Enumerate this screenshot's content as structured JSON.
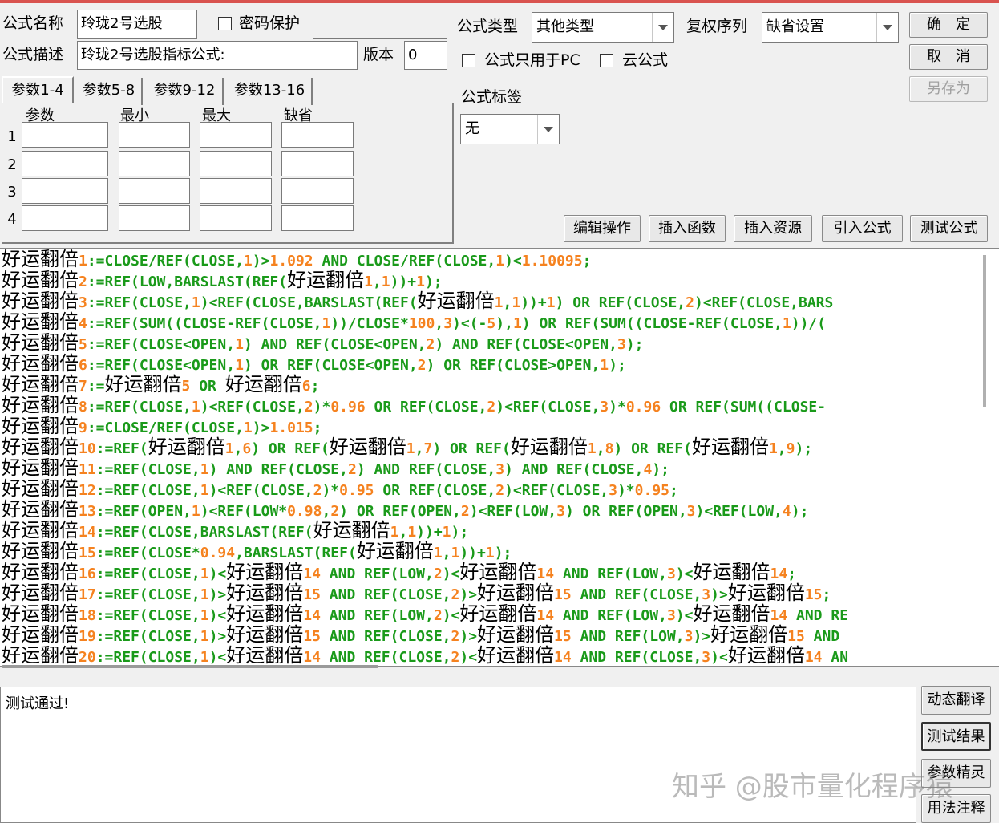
{
  "labels": {
    "name": "公式名称",
    "password": "密码保护",
    "desc": "公式描述",
    "version": "版本",
    "type": "公式类型",
    "fuquan": "复权序列",
    "pc_only": "公式只用于PC",
    "cloud": "云公式",
    "tag": "公式标签"
  },
  "values": {
    "name": "玲珑2号选股",
    "desc": "玲珑2号选股指标公式:",
    "version": "0",
    "type": "其他类型",
    "fuquan": "缺省设置",
    "tag": "无"
  },
  "buttons": {
    "ok": "确　定",
    "cancel": "取　消",
    "save_as": "另存为",
    "edit_ops": "编辑操作",
    "insert_func": "插入函数",
    "insert_res": "插入资源",
    "import": "引入公式",
    "test": "测试公式",
    "translate": "动态翻译",
    "test_result": "测试结果",
    "param_guide": "参数精灵",
    "usage": "用法注释"
  },
  "tabs": [
    "参数1-4",
    "参数5-8",
    "参数9-12",
    "参数13-16"
  ],
  "param_headers": [
    "参数",
    "最小",
    "最大",
    "缺省"
  ],
  "param_rows": [
    "1",
    "2",
    "3",
    "4"
  ],
  "code_lines": [
    "好运翻倍1:=CLOSE/REF(CLOSE,1)>1.092 AND CLOSE/REF(CLOSE,1)<1.10095;",
    "好运翻倍2:=REF(LOW,BARSLAST(REF(好运翻倍1,1))+1);",
    "好运翻倍3:=REF(CLOSE,1)<REF(CLOSE,BARSLAST(REF(好运翻倍1,1))+1) OR REF(CLOSE,2)<REF(CLOSE,BARS",
    "好运翻倍4:=REF(SUM((CLOSE-REF(CLOSE,1))/CLOSE*100,3)<(-5),1) OR REF(SUM((CLOSE-REF(CLOSE,1))/(",
    "好运翻倍5:=REF(CLOSE<OPEN,1) AND REF(CLOSE<OPEN,2) AND REF(CLOSE<OPEN,3);",
    "好运翻倍6:=REF(CLOSE<OPEN,1) OR REF(CLOSE<OPEN,2) OR REF(CLOSE>OPEN,1);",
    "好运翻倍7:=好运翻倍5 OR 好运翻倍6;",
    "好运翻倍8:=REF(CLOSE,1)<REF(CLOSE,2)*0.96 OR REF(CLOSE,2)<REF(CLOSE,3)*0.96 OR REF(SUM((CLOSE-",
    "好运翻倍9:=CLOSE/REF(CLOSE,1)>1.015;",
    "好运翻倍10:=REF(好运翻倍1,6) OR REF(好运翻倍1,7) OR REF(好运翻倍1,8) OR REF(好运翻倍1,9);",
    "好运翻倍11:=REF(CLOSE,1) AND REF(CLOSE,2) AND REF(CLOSE,3) AND REF(CLOSE,4);",
    "好运翻倍12:=REF(CLOSE,1)<REF(CLOSE,2)*0.95 OR REF(CLOSE,2)<REF(CLOSE,3)*0.95;",
    "好运翻倍13:=REF(OPEN,1)<REF(LOW*0.98,2) OR REF(OPEN,2)<REF(LOW,3) OR REF(OPEN,3)<REF(LOW,4);",
    "好运翻倍14:=REF(CLOSE,BARSLAST(REF(好运翻倍1,1))+1);",
    "好运翻倍15:=REF(CLOSE*0.94,BARSLAST(REF(好运翻倍1,1))+1);",
    "好运翻倍16:=REF(CLOSE,1)<好运翻倍14 AND REF(LOW,2)<好运翻倍14 AND REF(LOW,3)<好运翻倍14;",
    "好运翻倍17:=REF(CLOSE,1)>好运翻倍15 AND REF(CLOSE,2)>好运翻倍15 AND REF(CLOSE,3)>好运翻倍15;",
    "好运翻倍18:=REF(CLOSE,1)<好运翻倍14 AND REF(LOW,2)<好运翻倍14 AND REF(LOW,3)<好运翻倍14 AND RE",
    "好运翻倍19:=REF(CLOSE,1)>好运翻倍15 AND REF(CLOSE,2)>好运翻倍15 AND REF(LOW,3)>好运翻倍15 AND",
    "好运翻倍20:=REF(CLOSE,1)<好运翻倍14 AND REF(CLOSE,2)<好运翻倍14 AND REF(CLOSE,3)<好运翻倍14 AN"
  ],
  "output_text": "测试通过!",
  "watermark": "知乎 @股市量化程序猿"
}
